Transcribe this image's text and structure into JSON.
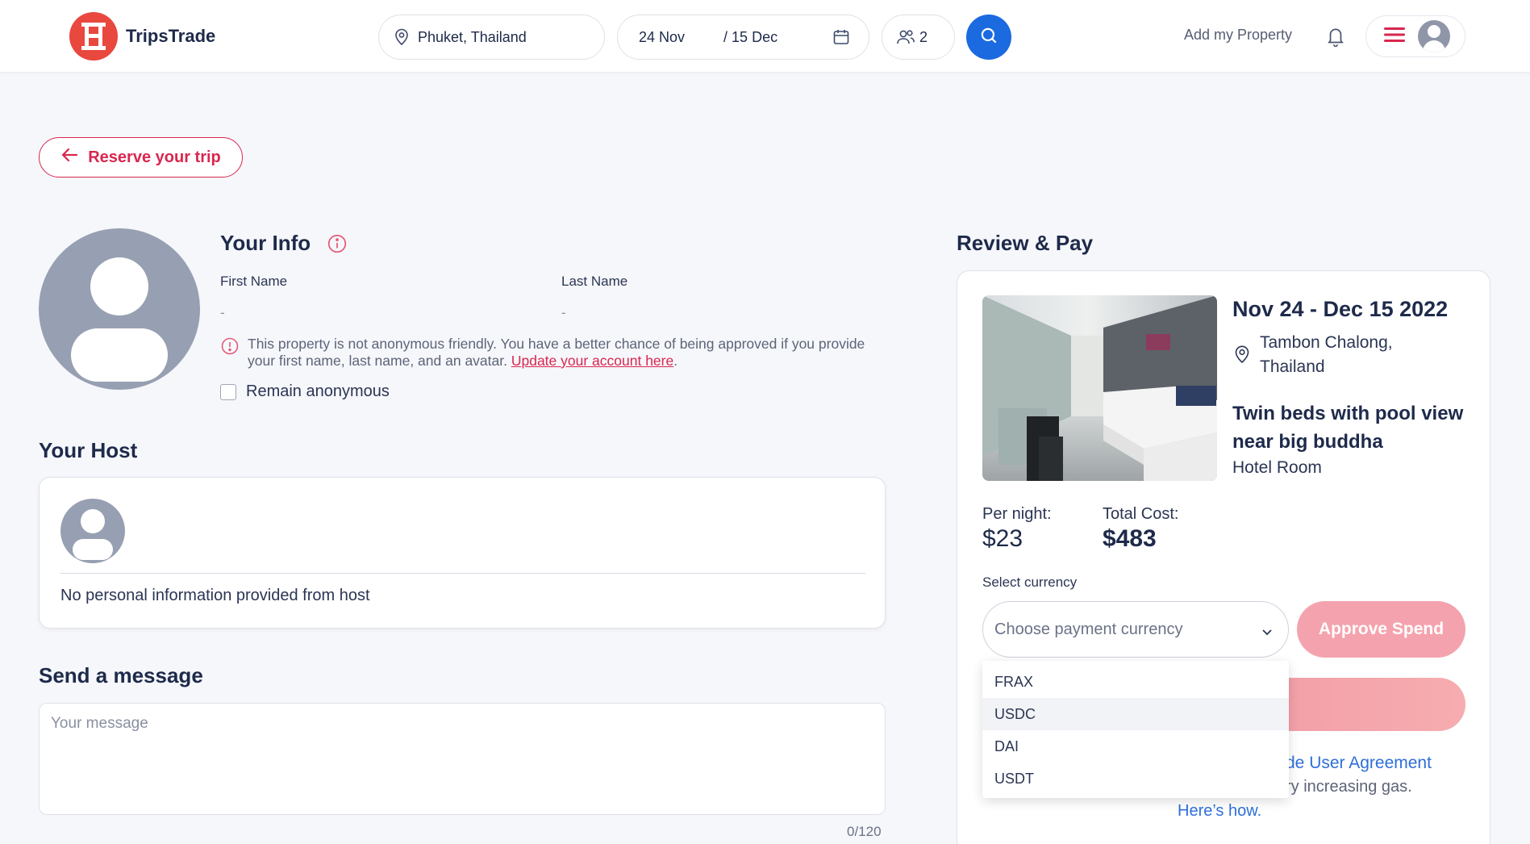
{
  "header": {
    "brand": "TripsTrade",
    "location": "Phuket, Thailand",
    "date_start": "24 Nov",
    "date_end": "/ 15 Dec",
    "guests": "2",
    "add_property": "Add my Property"
  },
  "back_button": {
    "label": "Reserve your trip"
  },
  "your_info": {
    "title": "Your Info",
    "first_name_label": "First Name",
    "first_name_value": "-",
    "last_name_label": "Last Name",
    "last_name_value": "-",
    "notice_text": "This property is not anonymous friendly. You have a better chance of being approved if you provide your first name, last name, and an avatar. ",
    "notice_link": "Update your account here",
    "notice_end": ".",
    "anonymous_label": "Remain anonymous"
  },
  "your_host": {
    "title": "Your Host",
    "info": "No personal information provided from host"
  },
  "message": {
    "title": "Send a message",
    "placeholder": "Your message",
    "counter": "0/120"
  },
  "review": {
    "title": "Review & Pay",
    "dates": "Nov 24 - Dec 15 2022",
    "location": "Tambon Chalong, Thailand",
    "room_name": "Twin beds with pool view near big buddha",
    "room_type": "Hotel Room",
    "per_night_label": "Per night:",
    "per_night_value": "$23",
    "total_label": "Total Cost:",
    "total_value": "$483",
    "currency_label": "Select currency",
    "currency_placeholder": "Choose payment currency",
    "approve_label": "Approve Spend",
    "agreement_fragment": "de User Agreement",
    "gas_fragment": "ry increasing gas.",
    "how_link": "Here’s how."
  },
  "currency_options": {
    "item_0": "FRAX",
    "item_1": "USDC",
    "item_2": "DAI",
    "item_3": "USDT"
  },
  "colors": {
    "accent": "#d9264f",
    "primary_blue": "#1b6ae0",
    "logo_red": "#e8483e",
    "approve_pink": "#f4a3ae"
  }
}
